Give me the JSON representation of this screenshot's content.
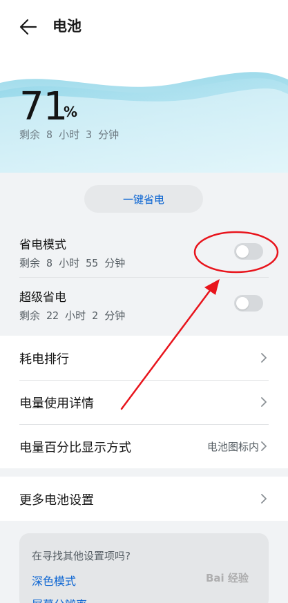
{
  "header": {
    "title": "电池",
    "back_icon": "back-arrow-icon"
  },
  "battery": {
    "percent": "71",
    "unit": "%",
    "remaining": "剩余 8 小时 3 分钟"
  },
  "quick_action": {
    "label": "一键省电"
  },
  "modes": [
    {
      "title": "省电模式",
      "subtitle": "剩余 8 小时 55 分钟",
      "enabled": false
    },
    {
      "title": "超级省电",
      "subtitle": "剩余 22 小时 2 分钟",
      "enabled": false
    }
  ],
  "list": [
    {
      "label": "耗电排行",
      "value": ""
    },
    {
      "label": "电量使用详情",
      "value": ""
    },
    {
      "label": "电量百分比显示方式",
      "value": "电池图标内"
    }
  ],
  "more": {
    "label": "更多电池设置"
  },
  "suggestions": {
    "question": "在寻找其他设置项吗?",
    "links": [
      "深色模式",
      "屏幕分辨率"
    ]
  },
  "watermark": "Bai 经验",
  "colors": {
    "accent": "#0a64d2",
    "wave_light": "#cdeef6",
    "wave_dark": "#8fd4e8",
    "annotation": "#e8141c"
  }
}
